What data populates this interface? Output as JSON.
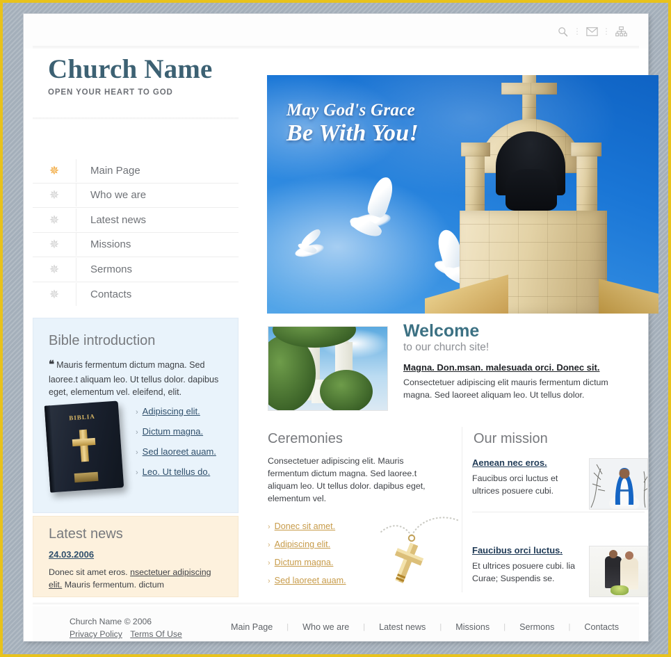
{
  "topbar": {
    "icons": [
      {
        "name": "search-icon",
        "title": "Search"
      },
      {
        "name": "mail-icon",
        "title": "Mail"
      },
      {
        "name": "sitemap-icon",
        "title": "Site map"
      }
    ]
  },
  "brand": {
    "title": "Church Name",
    "tagline": "OPEN YOUR HEART TO GOD",
    "title_color": "#3c6173"
  },
  "hero": {
    "line1": "May God's Grace",
    "line2": "Be With You!",
    "alt": "Stone bell tower with cross and flying white doves against blue sky"
  },
  "nav": {
    "items": [
      {
        "label": "Main Page",
        "active": true
      },
      {
        "label": "Who we are",
        "active": false
      },
      {
        "label": "Latest news",
        "active": false
      },
      {
        "label": "Missions",
        "active": false
      },
      {
        "label": "Sermons",
        "active": false
      },
      {
        "label": "Contacts",
        "active": false
      }
    ],
    "icon_name": "sun-burst-icon",
    "active_icon_color": "#f0a02a",
    "icon_color": "#cfcfcf"
  },
  "bible": {
    "heading": "Bible introduction",
    "quote_mark": "❝",
    "quote": "Mauris fermentum dictum magna. Sed laoree.t aliquam leo. Ut tellus dolor. dapibus eget, elementum vel. eleifend, elit.",
    "book_title": "BIBLIA",
    "links": [
      "Adipiscing elit. ",
      "Dictum magna. ",
      "Sed laoreet auam.",
      "Leo. Ut tellus do."
    ],
    "bg_color": "#e9f3fb"
  },
  "news": {
    "heading": "Latest news",
    "date": "24.03.2006",
    "body_pre": "Donec sit amet eros. ",
    "body_link": "nsectetuer adipiscing elit.",
    "body_post": " Mauris fermentum. dictum",
    "bg_color": "#fdf1dd"
  },
  "welcome": {
    "heading": "Welcome",
    "subheading": "to our church site!",
    "link": "Magna. Don.msan. malesuada orci. Donec sit. ",
    "body": "Consectetuer adipiscing elit mauris fermentum dictum magna. Sed laoreet aliquam leo. Ut tellus dolor.",
    "photo_alt": "White cathedral towers behind green trees",
    "heading_color": "#3c7183"
  },
  "ceremonies": {
    "heading": "Ceremonies",
    "body": "Consectetuer adipiscing elit. Mauris fermentum dictum magna. Sed laoree.t aliquam leo. Ut tellus dolor. dapibus eget, elementum vel.",
    "links": [
      "Donec sit amet. ",
      "Adipiscing elit. ",
      "Dictum magna. ",
      "Sed laoreet auam."
    ],
    "link_color": "#c79b49",
    "image_alt": "Gold cross pendant on a chain"
  },
  "mission": {
    "heading": "Our mission",
    "items": [
      {
        "link": "Aenean nec eros. ",
        "body": "Faucibus orci luctus et ultrices posuere cubi.",
        "thumb_alt": "Statue of Mary in blue robe among bare branches"
      },
      {
        "link": "Faucibus orci luctus",
        "link_suffix": ".",
        "body": "Et ultrices posuere cubi. lia Curae; Suspendis se.",
        "thumb_alt": "Bride and groom seated together"
      }
    ]
  },
  "footer": {
    "copyright": "Church Name © 2006",
    "privacy": "Privacy Policy",
    "terms": "Terms Of Use",
    "nav": [
      "Main Page",
      "Who we are",
      "Latest news",
      "Missions",
      "Sermons",
      "Contacts"
    ],
    "separator": "|"
  }
}
